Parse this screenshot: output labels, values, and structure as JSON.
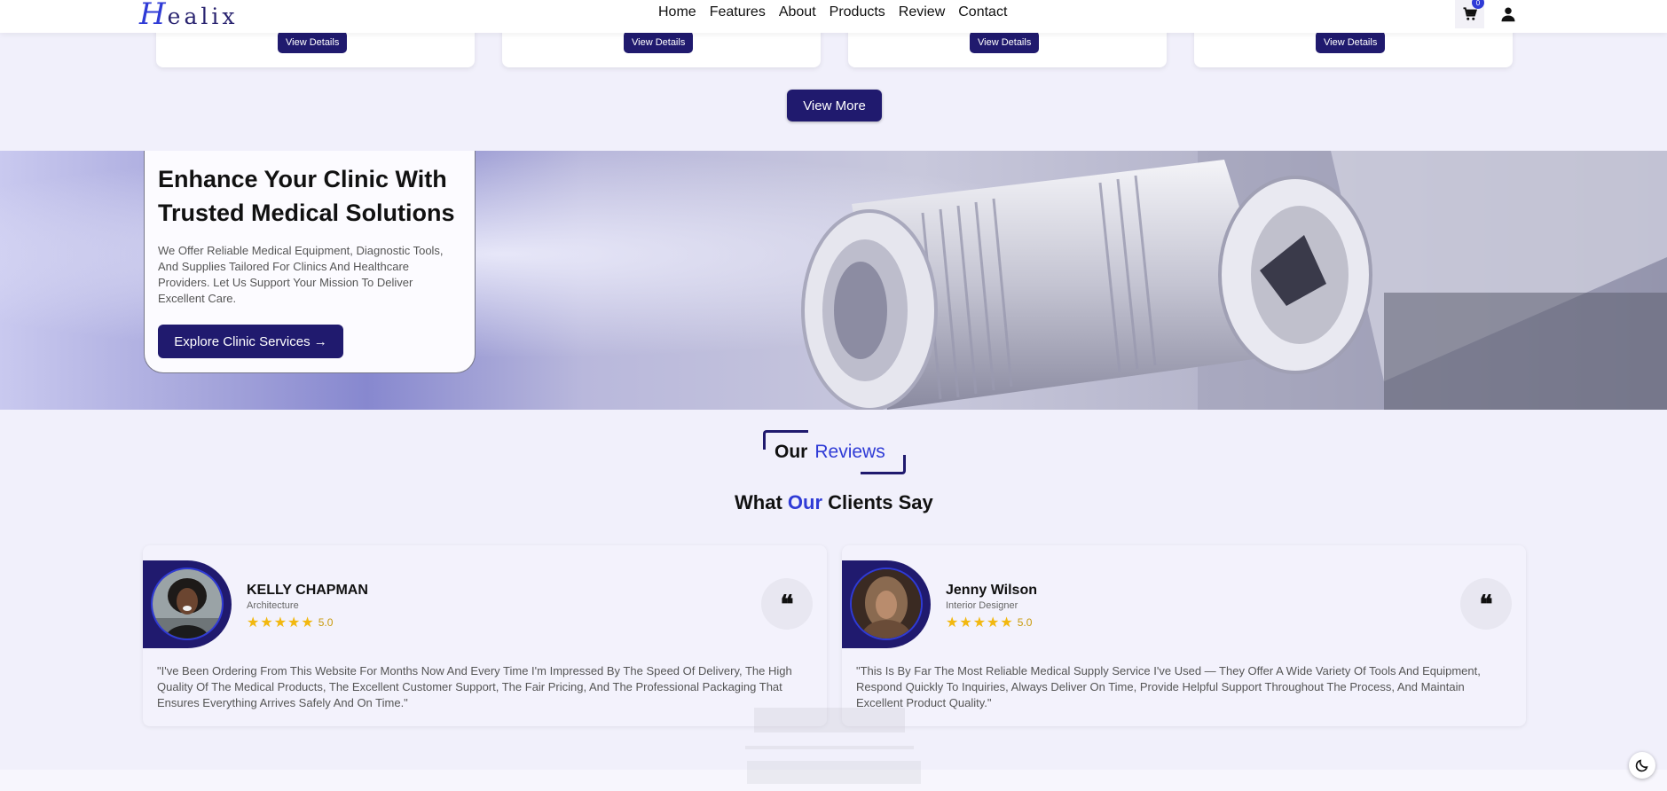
{
  "header": {
    "logo_initial": "H",
    "logo_rest": "ealix",
    "nav": [
      "Home",
      "Features",
      "About",
      "Products",
      "Review",
      "Contact"
    ],
    "cart_count": "0",
    "icons": {
      "cart": "cart-icon",
      "user": "user-icon"
    }
  },
  "products": {
    "details_labels": [
      "View Details",
      "View Details",
      "View Details",
      "View Details"
    ],
    "view_more": "View More"
  },
  "hero": {
    "title": "Enhance Your Clinic With Trusted Medical Solutions",
    "text": "We Offer Reliable Medical Equipment, Diagnostic Tools, And Supplies Tailored For Clinics And Healthcare Providers. Let Us Support Your Mission To Deliver Excellent Care.",
    "button": "Explore Clinic Services →"
  },
  "reviews": {
    "heading_a": "Our",
    "heading_b": "Reviews",
    "sub_a": "What ",
    "sub_b": "Our",
    "sub_c": " Clients Say",
    "items": [
      {
        "name": "KELLY CHAPMAN",
        "role": "Architecture",
        "rating": "5.0",
        "quote_icon": "quote-icon",
        "text": "\"I've Been Ordering From This Website For Months Now And Every Time I'm Impressed By The Speed Of Delivery, The High Quality Of The Medical Products, The Excellent Customer Support, The Fair Pricing, And The Professional Packaging That Ensures Everything Arrives Safely And On Time.\""
      },
      {
        "name": "Jenny Wilson",
        "role": "Interior Designer",
        "rating": "5.0",
        "quote_icon": "quote-icon",
        "text": "\"This Is By Far The Most Reliable Medical Supply Service I've Used — They Offer A Wide Variety Of Tools And Equipment, Respond Quickly To Inquiries, Always Deliver On Time, Provide Helpful Support Throughout The Process, And Maintain Excellent Product Quality.\""
      }
    ]
  },
  "colors": {
    "primary": "#201a6e",
    "accent": "#2f3bd6",
    "star": "#f2b80f"
  }
}
